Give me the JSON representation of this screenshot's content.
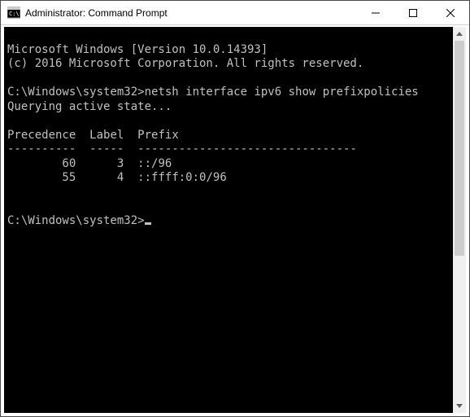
{
  "window": {
    "title": "Administrator: Command Prompt"
  },
  "console": {
    "banner1": "Microsoft Windows [Version 10.0.14393]",
    "banner2": "(c) 2016 Microsoft Corporation. All rights reserved.",
    "prompt1_path": "C:\\Windows\\system32>",
    "command": "netsh interface ipv6 show prefixpolicies",
    "status": "Querying active state...",
    "header_precedence": "Precedence",
    "header_label": "Label",
    "header_prefix": "Prefix",
    "divider": "----------  -----  --------------------------------",
    "rows": [
      {
        "precedence": "        60",
        "label": "      3",
        "prefix": "  ::/96"
      },
      {
        "precedence": "        55",
        "label": "      4",
        "prefix": "  ::ffff:0:0/96"
      }
    ],
    "prompt2_path": "C:\\Windows\\system32>"
  }
}
